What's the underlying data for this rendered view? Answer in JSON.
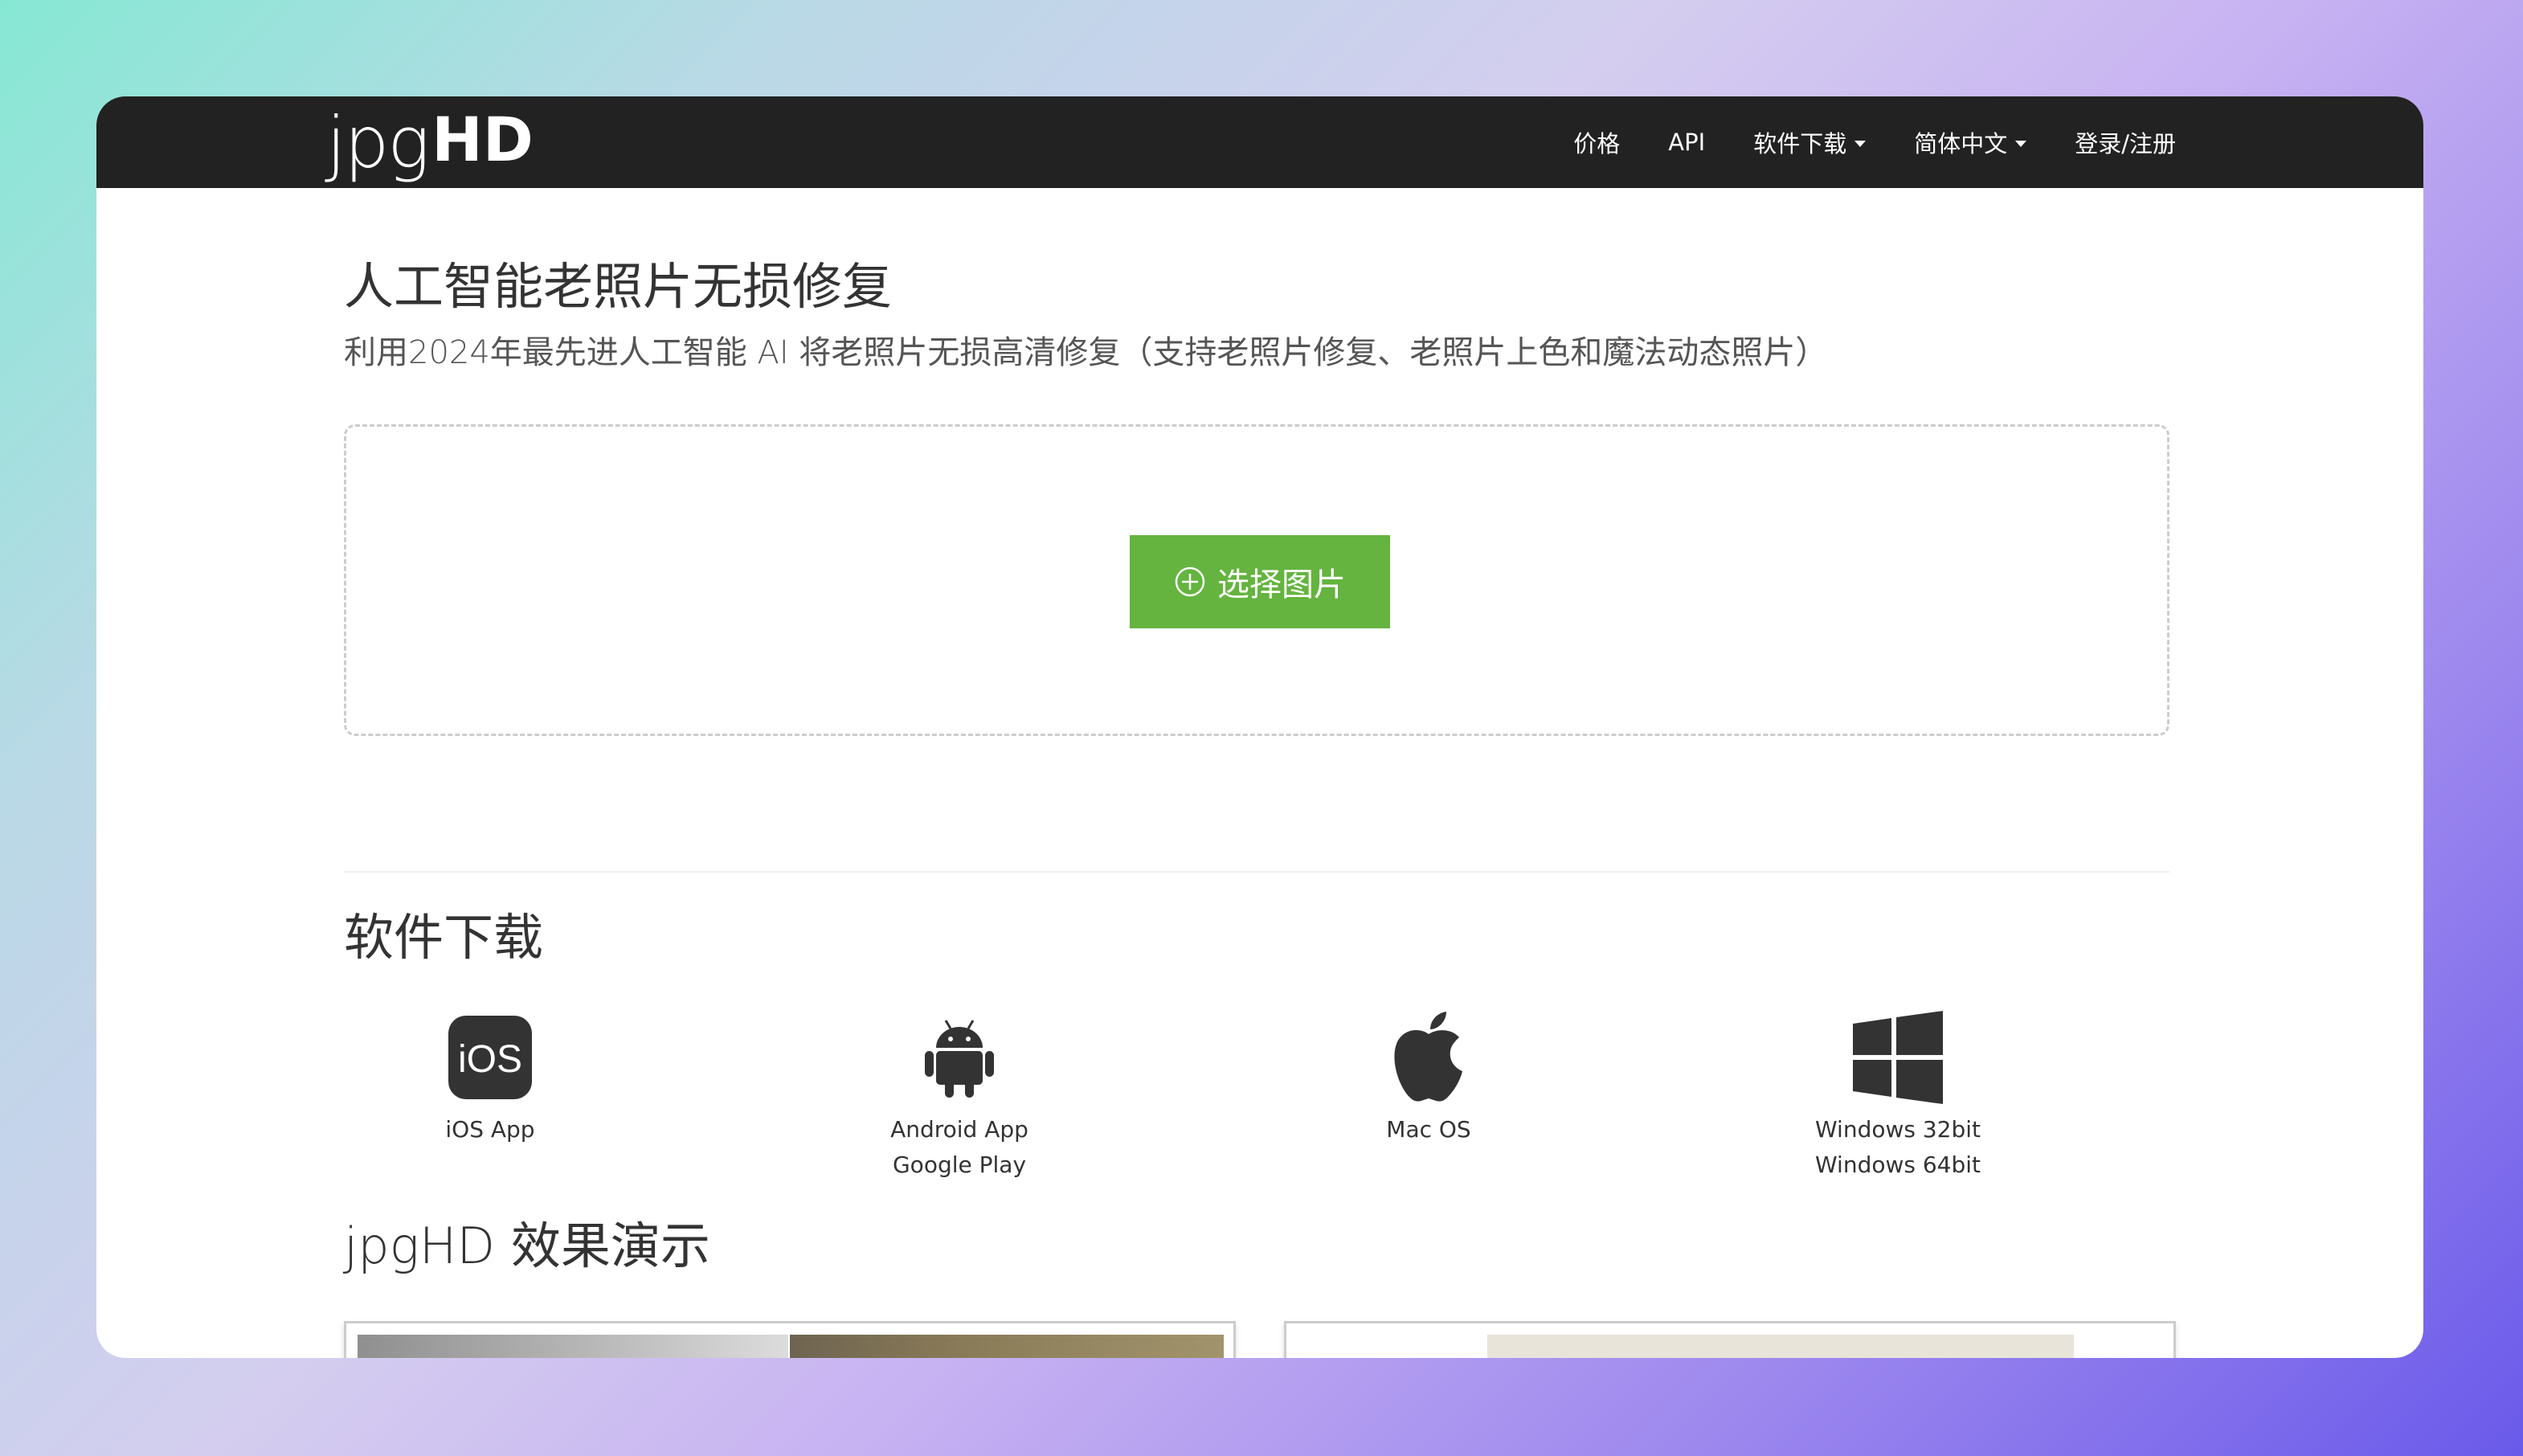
{
  "logo": {
    "light": "jpg",
    "bold": "HD"
  },
  "nav": {
    "items": [
      {
        "label": "价格",
        "dropdown": false
      },
      {
        "label": "API",
        "dropdown": false
      },
      {
        "label": "软件下载",
        "dropdown": true
      },
      {
        "label": "简体中文",
        "dropdown": true
      },
      {
        "label": "登录/注册",
        "dropdown": false
      }
    ]
  },
  "hero": {
    "title": "人工智能老照片无损修复",
    "subtitle": "利用2024年最先进人工智能 AI 将老照片无损高清修复（支持老照片修复、老照片上色和魔法动态照片）"
  },
  "upload": {
    "button_label": "选择图片",
    "button_icon": "plus-circle-icon"
  },
  "downloads": {
    "title": "软件下载",
    "items": [
      {
        "icon": "ios-icon",
        "icon_text": "iOS",
        "lines": [
          "iOS App"
        ]
      },
      {
        "icon": "android-icon",
        "lines": [
          "Android App",
          "Google Play"
        ]
      },
      {
        "icon": "apple-icon",
        "lines": [
          "Mac OS"
        ]
      },
      {
        "icon": "windows-icon",
        "lines": [
          "Windows 32bit",
          "Windows 64bit"
        ]
      }
    ]
  },
  "demo": {
    "title": "jpgHD 效果演示"
  },
  "colors": {
    "navbar": "#222222",
    "primary_button": "#64b43f",
    "text": "#333333"
  }
}
